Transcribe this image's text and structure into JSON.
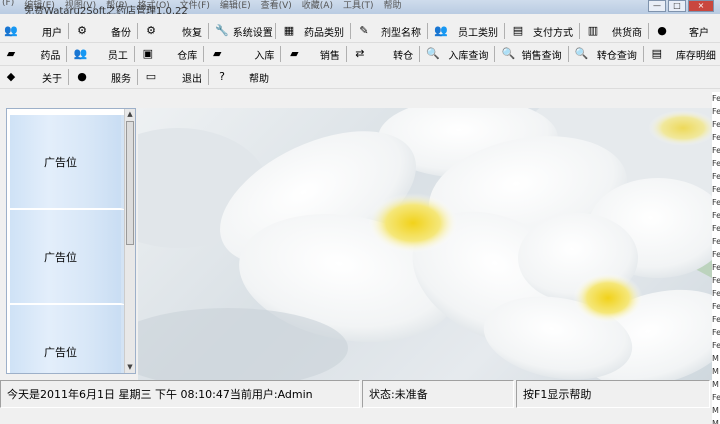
{
  "window": {
    "title": "免费Wataru2Soft之药店管理1.0.22",
    "menu_ghost": [
      "(F)",
      "编辑(E)",
      "视图(V)",
      "帮(P)",
      "格式(O)",
      "文件(F)",
      "编辑(E)",
      "查看(V)",
      "收藏(A)",
      "工具(T)",
      "帮助"
    ],
    "controls": [
      "—",
      "□",
      "×"
    ]
  },
  "toolbar1": [
    {
      "icon": "👥",
      "label": "用户"
    },
    {
      "icon": "⚙",
      "label": "备份"
    },
    {
      "icon": "⚙",
      "label": "恢复"
    },
    {
      "icon": "🔧",
      "label": "系统设置"
    },
    {
      "icon": "▦",
      "label": "药品类别"
    },
    {
      "icon": "✎",
      "label": "剂型名称"
    },
    {
      "icon": "👥",
      "label": "员工类别"
    },
    {
      "icon": "▤",
      "label": "支付方式"
    },
    {
      "icon": "▥",
      "label": "供货商"
    },
    {
      "icon": "●",
      "label": "客户"
    }
  ],
  "toolbar2": [
    {
      "icon": "▰",
      "label": "药品"
    },
    {
      "icon": "👥",
      "label": "员工"
    },
    {
      "icon": "▣",
      "label": "仓库"
    },
    {
      "icon": "▰",
      "label": "入库"
    },
    {
      "icon": "▰",
      "label": "销售"
    },
    {
      "icon": "⇄",
      "label": "转仓"
    },
    {
      "icon": "🔍",
      "label": "入库查询"
    },
    {
      "icon": "🔍",
      "label": "销售查询"
    },
    {
      "icon": "🔍",
      "label": "转仓查询"
    },
    {
      "icon": "▤",
      "label": "库存明细"
    }
  ],
  "toolbar3": [
    {
      "icon": "◆",
      "label": "关于"
    },
    {
      "icon": "●",
      "label": "服务"
    },
    {
      "icon": "▭",
      "label": "退出"
    },
    {
      "icon": "?",
      "label": "帮助"
    }
  ],
  "ads": [
    "广告位",
    "广告位",
    "广告位"
  ],
  "right_edge_glyphs": [
    "Fe",
    "Fe",
    "Fe",
    "Fe",
    "Fe",
    "Fe",
    "Fe",
    "Fe",
    "Fe",
    "Fe",
    "Fe",
    "Fe",
    "Fe",
    "Fe",
    "Fe",
    "Fe",
    "Fe",
    "Fe",
    "Fe",
    "Fe",
    "M",
    "M",
    "M",
    "Fe",
    "M",
    "M"
  ],
  "status": {
    "datetime": "今天是2011年6月1日  星期三  下午 08:10:47当前用户:Admin",
    "state": "状态:未准备",
    "help": "按F1显示帮助"
  },
  "colors": {
    "accent": "#cfe2f6",
    "petal": "#ffffff",
    "flower_center": "#f1d21a"
  }
}
